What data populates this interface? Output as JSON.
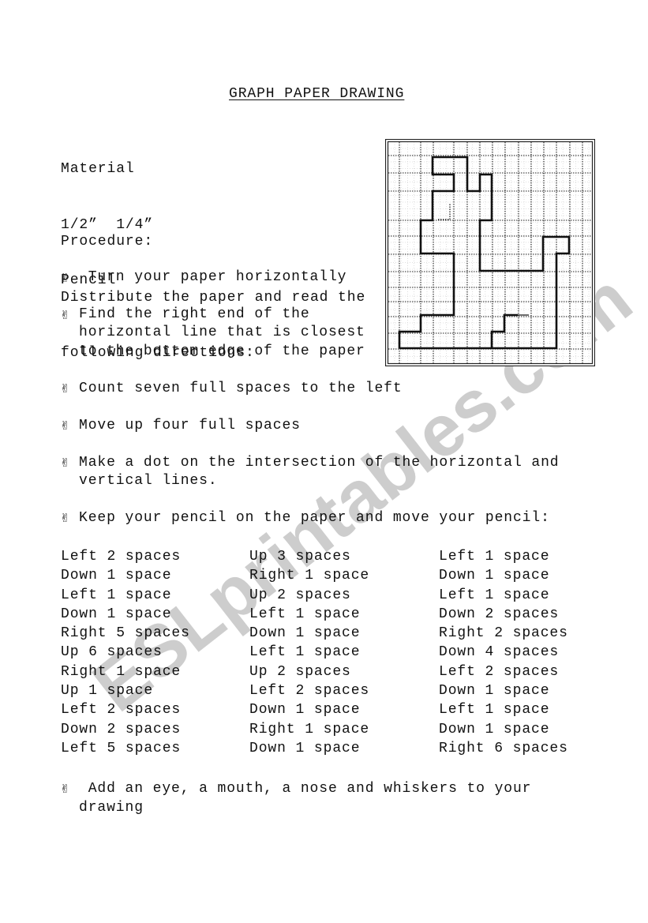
{
  "document": {
    "title": "GRAPH PAPER DRAWING",
    "material": {
      "heading": "Material",
      "items": [
        "1/2”  1/4”",
        "Pencil"
      ]
    },
    "procedure": {
      "heading": "Procedure:",
      "intro_lines": [
        "Distribute the paper and read the",
        "following directions:"
      ]
    },
    "bullet_icon": "victory-hand-icon",
    "bullet_glyph": "✌",
    "steps": [
      {
        "lines": [
          " Turn your paper horizontally"
        ]
      },
      {
        "lines": [
          "Find the right end of the",
          "horizontal line that is closest",
          "to the bottom edge of the paper"
        ]
      },
      {
        "lines": [
          "Count seven full spaces to the left"
        ]
      },
      {
        "lines": [
          "Move up four full spaces"
        ]
      },
      {
        "lines": [
          "Make a dot on the intersection of the horizontal and",
          "vertical lines."
        ]
      },
      {
        "lines": [
          "Keep your pencil on the paper and move your pencil:"
        ]
      }
    ],
    "directions": [
      [
        "Left 2 spaces",
        "Down 1 space",
        "Left 1 space",
        "Down 1 space",
        "Right 5 spaces",
        "Up 6 spaces",
        "Right 1 space",
        "Up 1 space",
        "Left 2 spaces",
        "Down 2 spaces",
        "Left 5 spaces"
      ],
      [
        "Up 3 spaces",
        "Right 1 space",
        "Up 2 spaces",
        "Left 1 space",
        "Down 1 space",
        "Left 1 space",
        "Up 2 spaces",
        "Left 2 spaces",
        "Down 1 space",
        "Right 1 space",
        "Down 1 space"
      ],
      [
        "Left 1 space",
        "Down 1 space",
        "Left 1 space",
        "Down 2 spaces",
        "Right 2 spaces",
        "Down 4 spaces",
        "Left 2 spaces",
        "Down 1 space",
        "Left 1 space",
        "Down 1 space",
        "Right 6 spaces"
      ]
    ],
    "final_step": {
      "lines": [
        " Add an eye, a mouth, a nose and whiskers to your",
        "drawing"
      ]
    },
    "watermark": "ESLprintables.com"
  },
  "colors": {
    "text": "#111111",
    "grid_line": "#222222",
    "faint_grid": "#d0d0d0",
    "watermark": "#c4c4c4"
  }
}
